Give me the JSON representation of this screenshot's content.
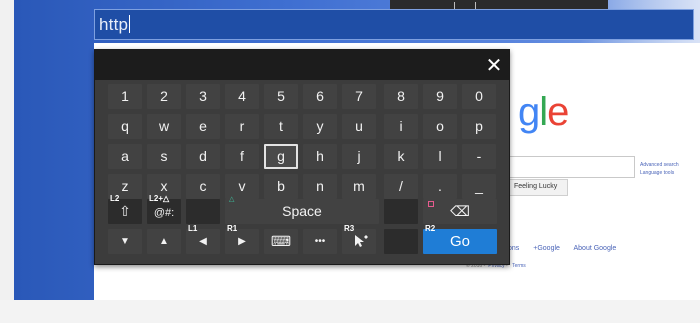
{
  "browser": {
    "url_text": "http"
  },
  "keyboard": {
    "close_symbol": "✕",
    "number_row": [
      "1",
      "2",
      "3",
      "4",
      "5",
      "6",
      "7",
      "8",
      "9",
      "0"
    ],
    "row_q": [
      "q",
      "w",
      "e",
      "r",
      "t",
      "y",
      "u",
      "i",
      "o",
      "p"
    ],
    "row_a": [
      "a",
      "s",
      "d",
      "f",
      "g",
      "h",
      "j",
      "k",
      "l",
      "-"
    ],
    "row_z": [
      "z",
      "x",
      "c",
      "v",
      "b",
      "n",
      "m",
      "/",
      ".",
      "_"
    ],
    "selected_key": "g",
    "shift": {
      "hint": "L2",
      "symbol": "⇧"
    },
    "symbols": {
      "hint": "L2+△",
      "label": "@#:"
    },
    "space": {
      "hint": "△",
      "label": "Space"
    },
    "backspace": {
      "hint": "□",
      "symbol": "⌫"
    },
    "nav": {
      "down": "▼",
      "up": "▲",
      "left_hint": "L1",
      "left": "◀",
      "right_hint": "R1",
      "right": "▶",
      "keyboard_icon": "⌨",
      "more": "•••",
      "r3_hint": "R3"
    },
    "go": {
      "hint": "R2",
      "label": "Go"
    }
  },
  "google_page": {
    "logo_text": "gle",
    "advanced_search": "Advanced search",
    "language_tools": "Language tools",
    "lucky_button": "Feeling Lucky",
    "footer_links": [
      "ons",
      "+Google",
      "About Google"
    ],
    "copyright": "© 2016 -",
    "privacy": "Privacy",
    "terms": "Terms"
  },
  "colors": {
    "ps_blue": "#2a58b8",
    "go_blue": "#1f7dd6",
    "google_blue": "#4285f4",
    "google_red": "#ea4335",
    "google_yellow": "#fbbc05",
    "google_green": "#34a853"
  }
}
